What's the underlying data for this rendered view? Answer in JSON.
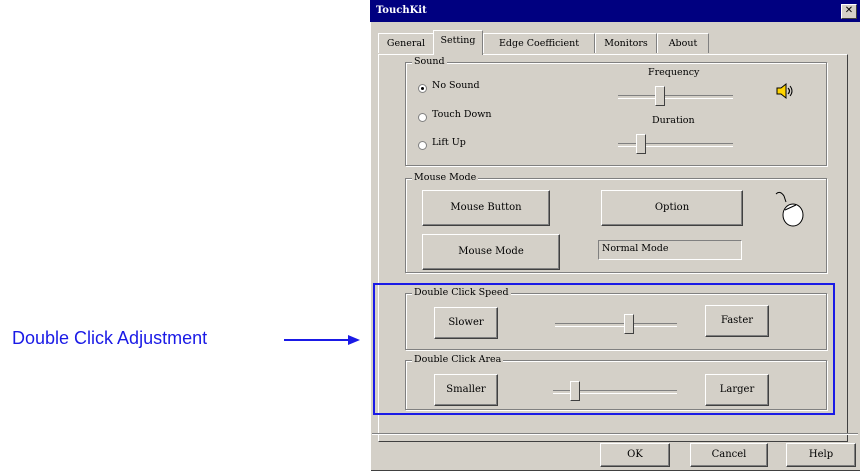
{
  "window": {
    "title": "TouchKit",
    "close_glyph": "✕"
  },
  "tabs": [
    {
      "label": "General",
      "active": false
    },
    {
      "label": "Setting",
      "active": true
    },
    {
      "label": "Edge Coefficient",
      "active": false
    },
    {
      "label": "Monitors",
      "active": false
    },
    {
      "label": "About",
      "active": false
    }
  ],
  "sound": {
    "legend": "Sound",
    "options": [
      "No Sound",
      "Touch Down",
      "Lift Up"
    ],
    "selected": "No Sound",
    "frequency_label": "Frequency",
    "duration_label": "Duration",
    "frequency_level": 0.35,
    "duration_level": 0.17,
    "speaker_icon": "speaker-icon"
  },
  "mouse_mode": {
    "legend": "Mouse Mode",
    "mouse_button_label": "Mouse Button",
    "option_label": "Option",
    "mouse_mode_label": "Mouse Mode",
    "mode_value": "Normal Mode",
    "mouse_icon": "mouse-icon"
  },
  "double_click_speed": {
    "legend": "Double Click Speed",
    "slower_label": "Slower",
    "faster_label": "Faster",
    "level": 0.62
  },
  "double_click_area": {
    "legend": "Double Click Area",
    "smaller_label": "Smaller",
    "larger_label": "Larger",
    "level": 0.15
  },
  "footer": {
    "ok_label": "OK",
    "cancel_label": "Cancel",
    "help_label": "Help"
  },
  "annotation": {
    "text": "Double Click Adjustment",
    "highlight_color": "#1a1ae6"
  }
}
